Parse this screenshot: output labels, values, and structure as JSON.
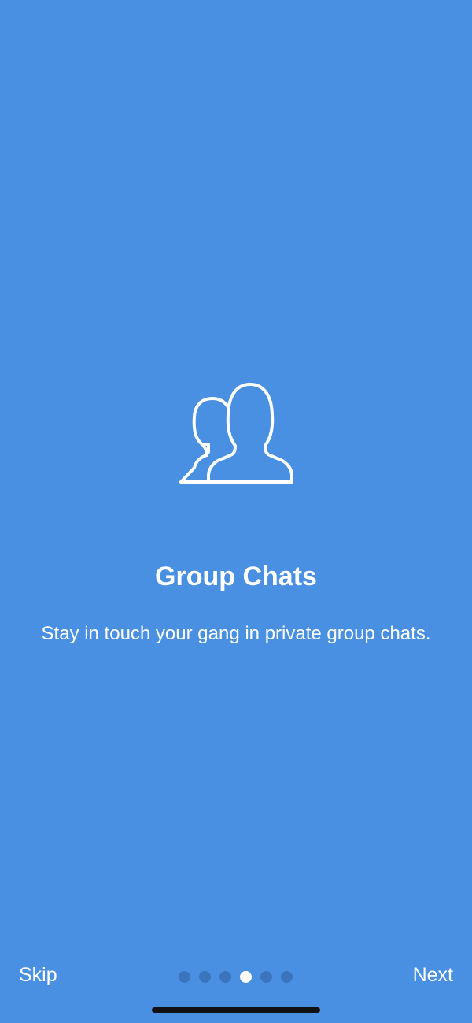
{
  "onboarding": {
    "icon": "group-people-icon",
    "title": "Group Chats",
    "subtitle": "Stay in touch your gang in private group chats."
  },
  "footer": {
    "skip_label": "Skip",
    "next_label": "Next",
    "page_count": 6,
    "current_page": 4
  },
  "colors": {
    "background": "#4a90e2",
    "text": "#ffffff",
    "inactive_dot": "#3a74bd",
    "active_dot": "#ffffff",
    "home_indicator": "#111111"
  }
}
